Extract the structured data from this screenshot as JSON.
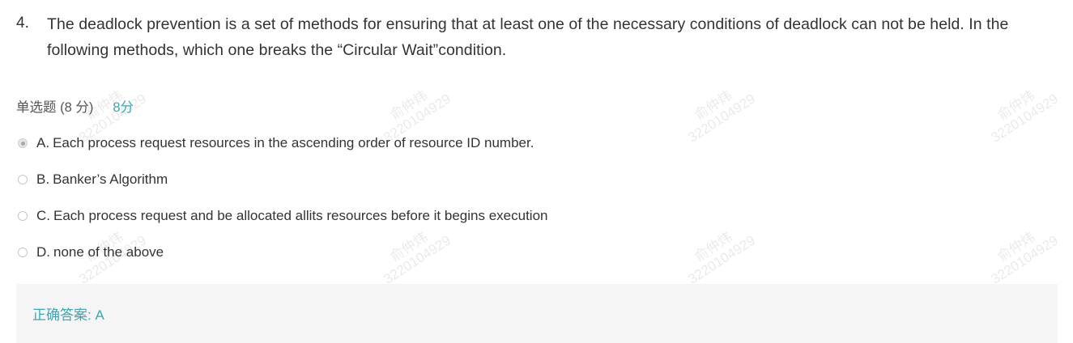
{
  "question": {
    "number": "4.",
    "text": "The deadlock prevention is a set of methods for ensuring that at least one of the necessary conditions of deadlock can not be held. In the following methods, which one breaks the “Circular Wait”condition."
  },
  "meta": {
    "type_label": "单选题 (8 分)",
    "score": "8分"
  },
  "options": [
    {
      "key": "A.",
      "text": "Each process request resources in the ascending order of resource ID number.",
      "selected": true
    },
    {
      "key": "B.",
      "text": "Banker’s Algorithm",
      "selected": false
    },
    {
      "key": "C.",
      "text": "Each process request and be allocated allits resources before it begins execution",
      "selected": false
    },
    {
      "key": "D.",
      "text": "none of the above",
      "selected": false
    }
  ],
  "answer": {
    "text": "正确答案: A"
  },
  "watermark": {
    "name": "俞仲炜",
    "id": "3220104929"
  },
  "colors": {
    "accent": "#3aa7b3",
    "text": "#333333",
    "answer_bg": "#f5f5f5"
  }
}
